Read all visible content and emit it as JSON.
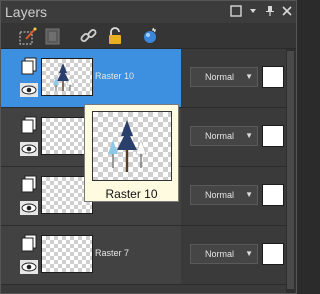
{
  "window": {
    "title": "Layers",
    "controls": [
      "window-maximize-icon",
      "dropdown-arrow-icon",
      "pin-icon",
      "close-icon"
    ]
  },
  "toolbar": {
    "tools": [
      "edit-selection-icon",
      "mask-icon",
      "link-icon",
      "lock-icon",
      "new-layer-icon"
    ]
  },
  "layers": [
    {
      "name": "Raster 10",
      "blend_mode": "Normal",
      "selected": true,
      "visible": true
    },
    {
      "name": "",
      "blend_mode": "Normal",
      "selected": false,
      "visible": true
    },
    {
      "name": "",
      "blend_mode": "Normal",
      "selected": false,
      "visible": true
    },
    {
      "name": "Raster 7",
      "blend_mode": "Normal",
      "selected": false,
      "visible": true
    }
  ],
  "tooltip": {
    "label": "Raster 10"
  },
  "colors": {
    "selection": "#3d8fe0",
    "panel_bg": "#333333",
    "tooltip_bg": "#fffbe1"
  }
}
